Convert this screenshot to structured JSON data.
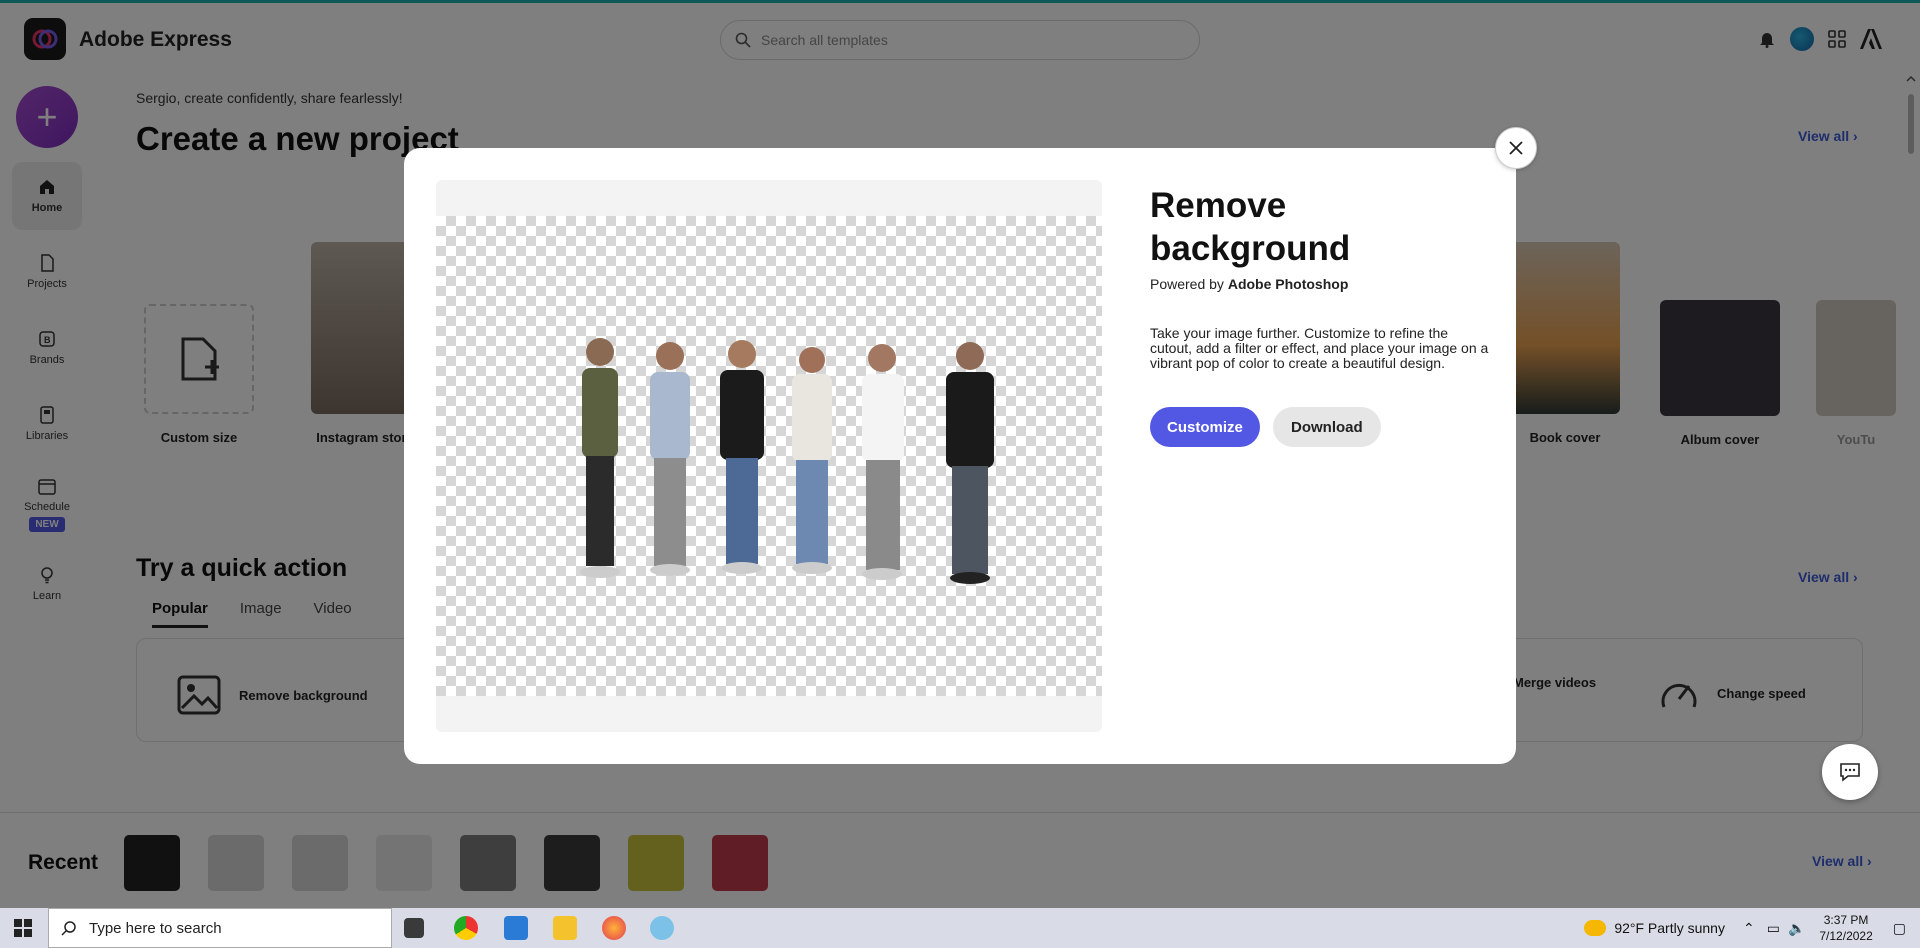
{
  "app": {
    "title": "Adobe Express",
    "search_placeholder": "Search all templates"
  },
  "sidebar": {
    "items": [
      {
        "label": "Home"
      },
      {
        "label": "Projects"
      },
      {
        "label": "Brands"
      },
      {
        "label": "Libraries"
      },
      {
        "label": "Schedule",
        "badge": "NEW"
      },
      {
        "label": "Learn"
      }
    ]
  },
  "main": {
    "greeting": "Sergio, create confidently, share fearlessly!",
    "create_title": "Create a new project",
    "view_all": "View all",
    "cards": [
      {
        "label": "Custom size"
      },
      {
        "label": "Instagram story"
      },
      {
        "label": "Book cover"
      },
      {
        "label": "Album cover"
      },
      {
        "label": "YouTu"
      }
    ],
    "quick_title": "Try a quick action",
    "tabs": [
      "Popular",
      "Image",
      "Video"
    ],
    "quick_actions": [
      {
        "label": "Remove background"
      },
      {
        "label": "Merge videos"
      },
      {
        "label": "Change speed"
      }
    ],
    "recent_title": "Recent"
  },
  "modal": {
    "title": "Remove background",
    "powered_prefix": "Powered by",
    "powered_brand": "Adobe Photoshop",
    "description": "Take your image further. Customize to refine the cutout, add a filter or effect, and place your image on a vibrant pop of color to create a beautiful design.",
    "customize_label": "Customize",
    "download_label": "Download"
  },
  "taskbar": {
    "search_placeholder": "Type here to search",
    "weather": "92°F  Partly sunny",
    "time": "3:37 PM",
    "date": "7/12/2022"
  },
  "colors": {
    "accent": "#5258e4",
    "link": "#3c5bd8",
    "overlay": "rgba(0,0,0,0.5)"
  }
}
